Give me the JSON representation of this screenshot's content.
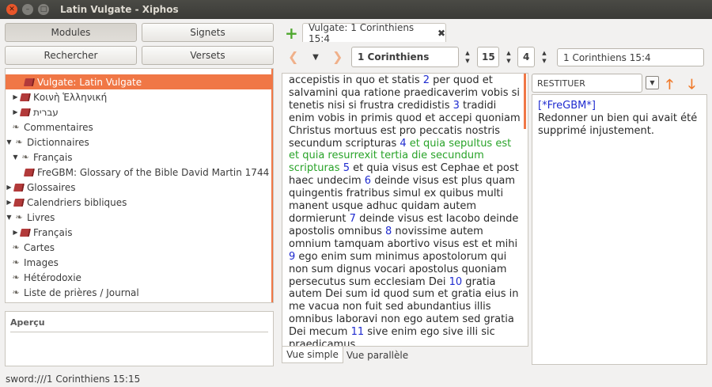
{
  "window": {
    "title": "Latin Vulgate - Xiphos"
  },
  "left_buttons": {
    "modules": "Modules",
    "signets": "Signets",
    "rechercher": "Rechercher",
    "versets": "Versets"
  },
  "tree": [
    {
      "label": "Vulgate: Latin Vulgate",
      "icon": "book-icon",
      "selected": true
    },
    {
      "label": "Κοινὴ Ἑλληνική",
      "icon": "book-icon"
    },
    {
      "label": "עברית",
      "icon": "book-icon"
    },
    {
      "label": "Commentaires",
      "icon": "shelf-icon"
    },
    {
      "label": "Dictionnaires",
      "icon": "shelf-icon"
    },
    {
      "label": "Français",
      "icon": "shelf-icon"
    },
    {
      "label": "FreGBM: Glossary of the Bible David Martin 1744",
      "icon": "book-icon"
    },
    {
      "label": "Glossaires",
      "icon": "book-icon"
    },
    {
      "label": "Calendriers bibliques",
      "icon": "book-icon"
    },
    {
      "label": "Livres",
      "icon": "shelf-icon"
    },
    {
      "label": "Français",
      "icon": "book-icon"
    },
    {
      "label": "Cartes",
      "icon": "shelf-icon"
    },
    {
      "label": "Images",
      "icon": "shelf-icon"
    },
    {
      "label": "Hétérodoxie",
      "icon": "shelf-icon"
    },
    {
      "label": "Liste de prières / Journal",
      "icon": "shelf-icon"
    }
  ],
  "apercu": {
    "label": "Aperçu"
  },
  "tab": {
    "label": "Vulgate: 1 Corinthiens 15:4"
  },
  "nav": {
    "book": "1 Corinthiens",
    "chapter": "15",
    "verse": "4",
    "reference": "1 Corinthiens 15:4"
  },
  "text": [
    {
      "n": "",
      "t": "accepistis in quo et statis "
    },
    {
      "n": "2",
      "t": " per quod et salvamini qua ratione praedicaverim vobis si tenetis nisi si frustra credidistis "
    },
    {
      "n": "3",
      "t": " tradidi enim vobis in primis quod et accepi quoniam Christus mortuus est pro peccatis nostris secundum scripturas "
    },
    {
      "n": "4",
      "t": " et quia sepultus est et quia resurrexit tertia die secundum scripturas",
      "highlight": true
    },
    {
      "n": "5",
      "t": " et quia visus est Cephae et post haec undecim "
    },
    {
      "n": "6",
      "t": " deinde visus est plus quam quingentis fratribus simul ex quibus multi manent usque adhuc quidam autem dormierunt "
    },
    {
      "n": "7",
      "t": " deinde visus est Iacobo deinde apostolis omnibus "
    },
    {
      "n": "8",
      "t": " novissime autem omnium tamquam abortivo visus est et mihi "
    },
    {
      "n": "9",
      "t": " ego enim sum minimus apostolorum qui non sum dignus vocari apostolus quoniam persecutus sum ecclesiam Dei "
    },
    {
      "n": "10",
      "t": " gratia autem Dei sum id quod sum et gratia eius in me vacua non fuit sed abundantius illis omnibus laboravi non ego autem sed gratia Dei mecum "
    },
    {
      "n": "11",
      "t": " sive enim ego sive illi sic praedicamus"
    }
  ],
  "bottom_tabs": {
    "simple": "Vue simple",
    "parallel": "Vue parallèle"
  },
  "dict": {
    "keyword": "RESTITUER",
    "source": "[*FreGBM*]",
    "definition": "Redonner un bien qui avait été supprimé injustement."
  },
  "status": {
    "text": "sword:///1 Corinthiens 15:15"
  }
}
